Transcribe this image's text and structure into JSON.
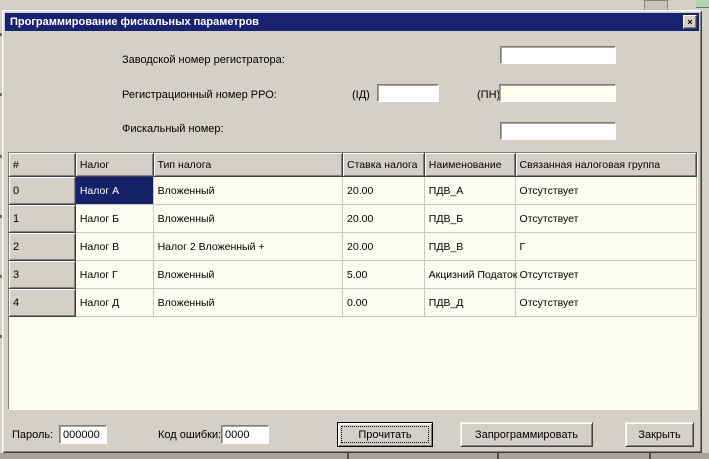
{
  "window": {
    "title": "Программирование фискальных параметров",
    "close_glyph": "×"
  },
  "form": {
    "factory_number_label": "Заводской номер регистратора:",
    "factory_number_value": "",
    "registration_label": "Регистрационный номер РРО:",
    "id_label": "(ІД)",
    "id_value": "",
    "pn_label": "(ПН)",
    "pn_value": "",
    "fiscal_label": "Фискальный номер:",
    "fiscal_value": ""
  },
  "table": {
    "columns": [
      "#",
      "Налог",
      "Тип налога",
      "Ставка налога",
      "Наименование",
      "Связанная налоговая группа"
    ],
    "rows": [
      {
        "num": "0",
        "tax": "Налог А",
        "type": "Вложенный",
        "rate": "20.00",
        "name": "ПДВ_А",
        "group": "Отсутствует"
      },
      {
        "num": "1",
        "tax": "Налог Б",
        "type": "Вложенный",
        "rate": "20.00",
        "name": "ПДВ_Б",
        "group": "Отсутствует"
      },
      {
        "num": "2",
        "tax": "Налог В",
        "type": "Налог 2  Вложенный +",
        "rate": "20.00",
        "name": "ПДВ_В",
        "group": "Г"
      },
      {
        "num": "3",
        "tax": "Налог Г",
        "type": "Вложенный",
        "rate": "5.00",
        "name": "Акцизний Податок",
        "group": "Отсутствует"
      },
      {
        "num": "4",
        "tax": "Налог Д",
        "type": "Вложенный",
        "rate": "0.00",
        "name": "ПДВ_Д",
        "group": "Отсутствует"
      }
    ],
    "selected": {
      "row": 0,
      "column_index": 1
    }
  },
  "footer": {
    "password_label": "Пароль:",
    "password_value": "000000",
    "error_code_label": "Код ошибки:",
    "error_code_value": "0000",
    "read_button": "Прочитать",
    "program_button": "Запрограммировать",
    "close_button": "Закрыть"
  },
  "colors": {
    "titlebar": "#182270",
    "dialog_bg": "#d4d0c8",
    "grid_cell_bg": "#fcfcf0",
    "selected_cell_bg": "#152168",
    "pn_field_bg": "#fffff0"
  }
}
